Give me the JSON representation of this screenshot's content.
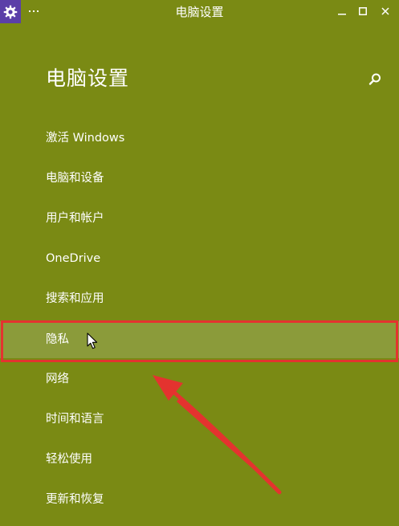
{
  "window": {
    "title": "电脑设置",
    "app_icon": "gear-icon",
    "controls": {
      "minimize": "minimize-icon",
      "maximize": "maximize-icon",
      "close": "close-icon"
    }
  },
  "page": {
    "heading": "电脑设置",
    "search_icon": "search-icon"
  },
  "nav": {
    "items": [
      {
        "label": "激活 Windows"
      },
      {
        "label": "电脑和设备"
      },
      {
        "label": "用户和帐户"
      },
      {
        "label": "OneDrive"
      },
      {
        "label": "搜索和应用"
      },
      {
        "label": "隐私"
      },
      {
        "label": "网络"
      },
      {
        "label": "时间和语言"
      },
      {
        "label": "轻松使用"
      },
      {
        "label": "更新和恢复"
      }
    ],
    "selected_index": 5
  },
  "colors": {
    "background": "#7a8a14",
    "selected_background": "#8b9b3a",
    "app_icon_background": "#5b3fa8",
    "annotation_red": "#e4332f",
    "text": "#ffffff"
  }
}
